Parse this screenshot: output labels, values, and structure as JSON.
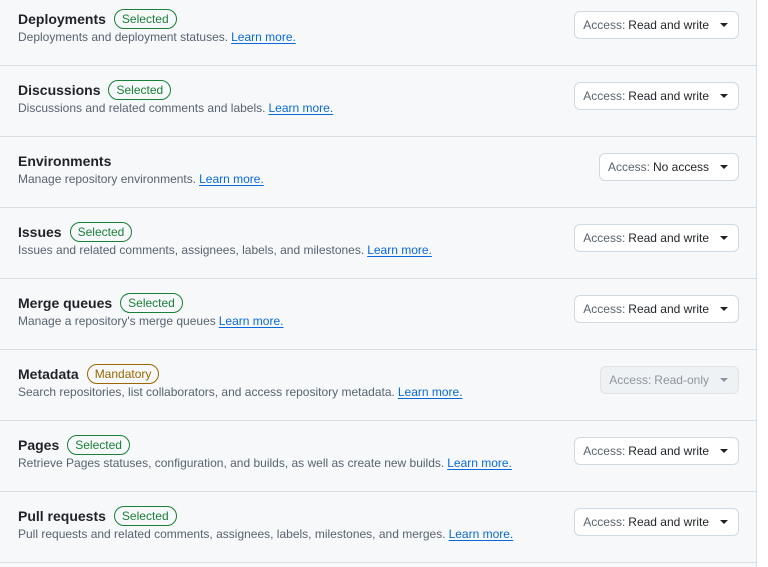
{
  "permissions": [
    {
      "name": "Deployments",
      "badge": "Selected",
      "description": "Deployments and deployment statuses.",
      "link": "Learn more.",
      "access_prefix": "Access:",
      "access_value": "Read and write"
    },
    {
      "name": "Discussions",
      "badge": "Selected",
      "description": "Discussions and related comments and labels.",
      "link": "Learn more.",
      "access_prefix": "Access:",
      "access_value": "Read and write"
    },
    {
      "name": "Environments",
      "badge": "",
      "description": "Manage repository environments.",
      "link": "Learn more.",
      "access_prefix": "Access:",
      "access_value": "No access"
    },
    {
      "name": "Issues",
      "badge": "Selected",
      "description": "Issues and related comments, assignees, labels, and milestones.",
      "link": "Learn more.",
      "access_prefix": "Access:",
      "access_value": "Read and write"
    },
    {
      "name": "Merge queues",
      "badge": "Selected",
      "description": "Manage a repository's merge queues",
      "link": "Learn more.",
      "access_prefix": "Access:",
      "access_value": "Read and write"
    },
    {
      "name": "Metadata",
      "badge": "Mandatory",
      "description": "Search repositories, list collaborators, and access repository metadata.",
      "link": "Learn more.",
      "access_prefix": "Access:",
      "access_value": "Read-only"
    },
    {
      "name": "Pages",
      "badge": "Selected",
      "description": "Retrieve Pages statuses, configuration, and builds, as well as create new builds.",
      "link": "Learn more.",
      "access_prefix": "Access:",
      "access_value": "Read and write"
    },
    {
      "name": "Pull requests",
      "badge": "Selected",
      "description": "Pull requests and related comments, assignees, labels, milestones, and merges.",
      "link": "Learn more.",
      "access_prefix": "Access:",
      "access_value": "Read and write"
    }
  ],
  "colors": {
    "selected_badge": "#1a7f37",
    "mandatory_badge": "#9a6700",
    "link": "#0969da"
  }
}
